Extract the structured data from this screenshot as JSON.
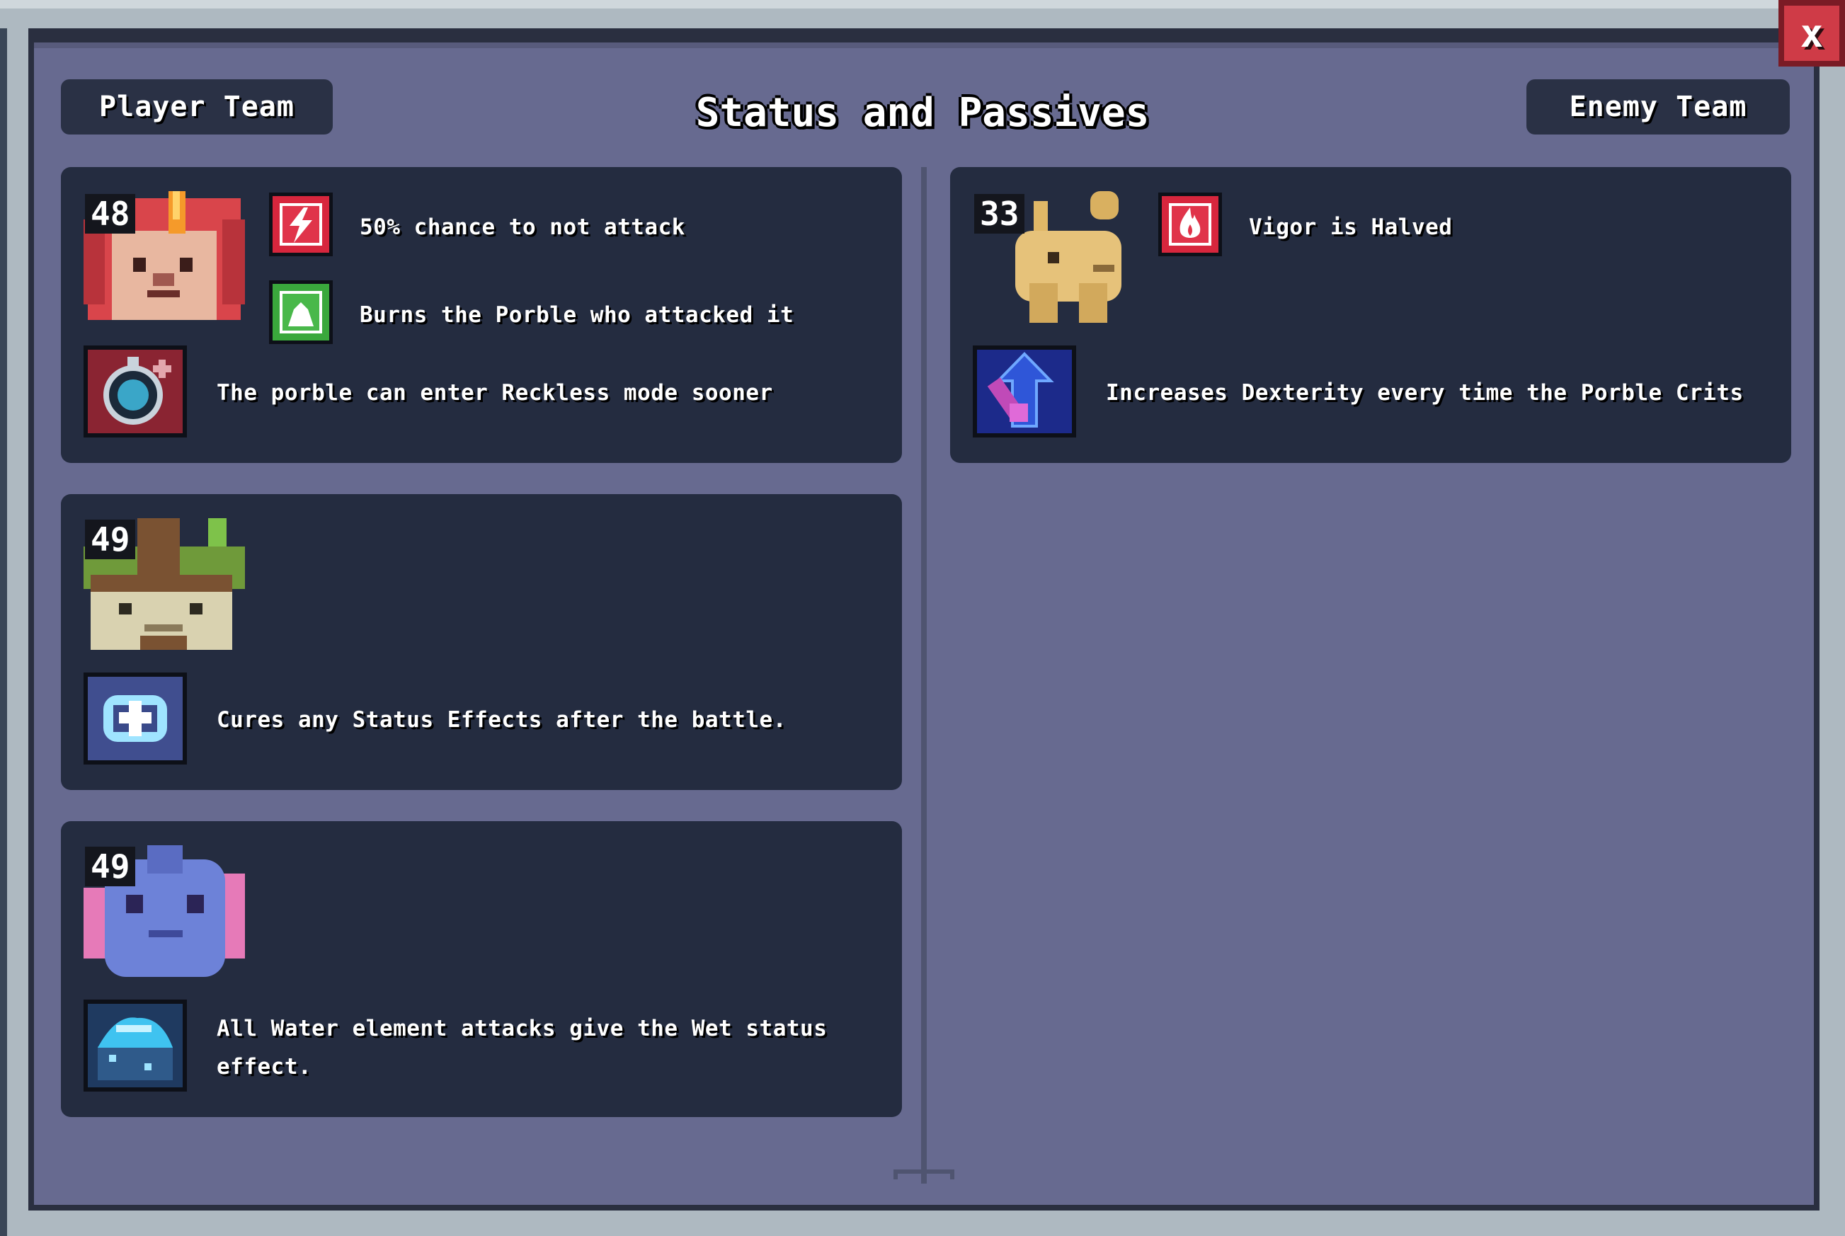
{
  "window": {
    "title": "Status and Passives",
    "close_label": "x"
  },
  "tabs": {
    "player": "Player Team",
    "enemy": "Enemy Team"
  },
  "player_team": [
    {
      "level": "48",
      "portrait": "lion-unicorn-porble",
      "statuses": [
        {
          "icon": "lightning-status-icon",
          "color": "#d7263d",
          "text": "50% chance to not attack"
        },
        {
          "icon": "mound-status-icon",
          "color": "#3aa83c",
          "text": "Burns the Porble who attacked it"
        }
      ],
      "passive": {
        "icon": "stopwatch-passive-icon",
        "text": "The porble can enter Reckless mode sooner"
      }
    },
    {
      "level": "49",
      "portrait": "tree-stump-frog-porble",
      "statuses": [],
      "passive": {
        "icon": "heal-hands-passive-icon",
        "text": "Cures any Status Effects after the battle."
      }
    },
    {
      "level": "49",
      "portrait": "axolotl-porble",
      "statuses": [],
      "passive": {
        "icon": "water-splash-passive-icon",
        "text": "All Water element attacks give the Wet status effect."
      }
    }
  ],
  "enemy_team": [
    {
      "level": "33",
      "portrait": "camel-llama-porble",
      "statuses": [
        {
          "icon": "fire-status-icon",
          "color": "#d7263d",
          "text": "Vigor is Halved"
        }
      ],
      "passive": {
        "icon": "dagger-up-passive-icon",
        "text": "Increases Dexterity every time the Porble Crits"
      }
    }
  ]
}
